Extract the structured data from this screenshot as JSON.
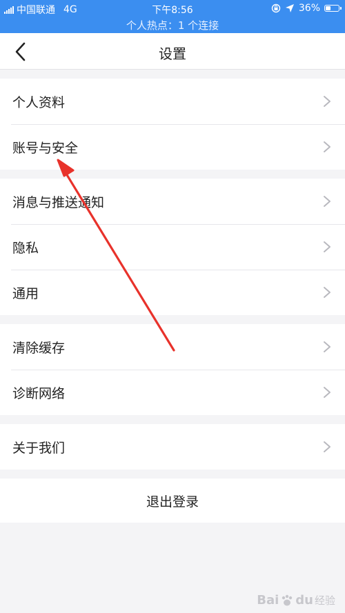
{
  "status_bar": {
    "carrier": "中国联通",
    "network": "4G",
    "time": "下午8:56",
    "battery": "36%",
    "battery_level": 0.36,
    "hotspot_text": "个人热点：1 个连接"
  },
  "nav": {
    "title": "设置"
  },
  "groups": [
    {
      "items": [
        {
          "label": "个人资料"
        },
        {
          "label": "账号与安全"
        }
      ]
    },
    {
      "items": [
        {
          "label": "消息与推送通知"
        },
        {
          "label": "隐私"
        },
        {
          "label": "通用"
        }
      ]
    },
    {
      "items": [
        {
          "label": "清除缓存"
        },
        {
          "label": "诊断网络"
        }
      ]
    },
    {
      "items": [
        {
          "label": "关于我们"
        }
      ]
    }
  ],
  "logout_label": "退出登录",
  "watermark": {
    "brand": "Bai",
    "paw": "du",
    "suffix": "经验"
  },
  "colors": {
    "status_bar_bg": "#3b8ef0",
    "annotation_arrow": "#e8322b",
    "chevron": "#b8b8be"
  }
}
